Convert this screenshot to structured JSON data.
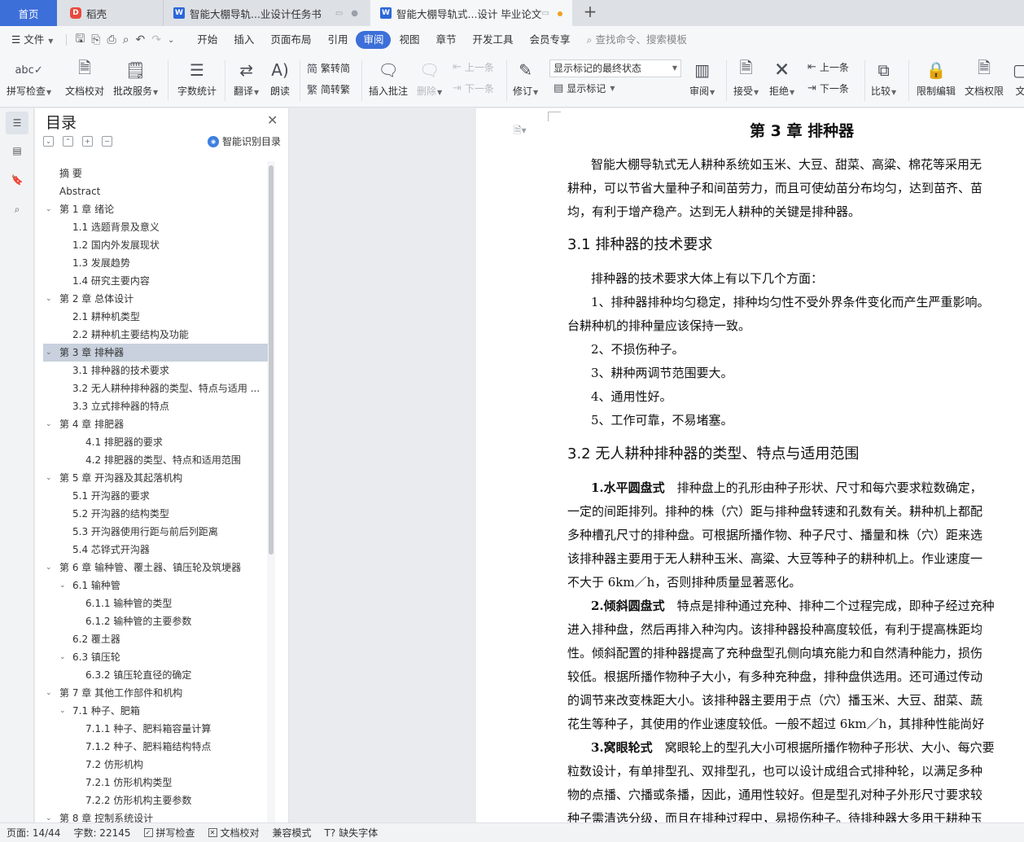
{
  "tabs": {
    "home": "首页",
    "docer": "稻壳",
    "doc1": "智能大棚导轨...业设计任务书",
    "doc2": "智能大棚导轨式...设计 毕业论文",
    "add": "+"
  },
  "menu": {
    "file": "文件",
    "items": [
      "开始",
      "插入",
      "页面布局",
      "引用",
      "审阅",
      "视图",
      "章节",
      "开发工具",
      "会员专享"
    ],
    "active": "审阅",
    "search_placeholder": "查找命令、搜索模板"
  },
  "ribbon": {
    "spell": "拼写检查",
    "doc_proof": "文档校对",
    "annotate_service": "批改服务",
    "word_count": "字数统计",
    "translate": "翻译",
    "read_aloud": "朗读",
    "trad": "繁转简",
    "simp": "简转繁",
    "insert_comment": "插入批注",
    "delete": "删除",
    "prev": "上一条",
    "next": "下一条",
    "track": "修订",
    "markup_select": "显示标记的最终状态",
    "show_markup": "显示标记",
    "review": "审阅",
    "accept": "接受",
    "reject": "拒绝",
    "prev2": "上一条",
    "next2": "下一条",
    "compare": "比较",
    "restrict": "限制编辑",
    "doc_perm": "文档权限",
    "more": "文"
  },
  "toc": {
    "title": "目录",
    "smart": "智能识别目录",
    "items": [
      {
        "text": "摘    要",
        "level": 0
      },
      {
        "text": "Abstract",
        "level": 0
      },
      {
        "text": "第 1 章  绪论",
        "level": 0,
        "exp": true
      },
      {
        "text": "1.1 选题背景及意义",
        "level": 1
      },
      {
        "text": "1.2 国内外发展现状",
        "level": 1
      },
      {
        "text": "1.3 发展趋势",
        "level": 1
      },
      {
        "text": "1.4 研究主要内容",
        "level": 1
      },
      {
        "text": "第 2 章  总体设计",
        "level": 0,
        "exp": true
      },
      {
        "text": "2.1 耕种机类型",
        "level": 1
      },
      {
        "text": "2.2 耕种机主要结构及功能",
        "level": 1
      },
      {
        "text": "第 3 章  排种器",
        "level": 0,
        "exp": true,
        "sel": true
      },
      {
        "text": "3.1 排种器的技术要求",
        "level": 1
      },
      {
        "text": "3.2 无人耕种排种器的类型、特点与适用 ...",
        "level": 1
      },
      {
        "text": "3.3 立式排种器的特点",
        "level": 1
      },
      {
        "text": "第 4 章  排肥器",
        "level": 0,
        "exp": true
      },
      {
        "text": "4.1 排肥器的要求",
        "level": 2
      },
      {
        "text": "4.2 排肥器的类型、特点和适用范围",
        "level": 2
      },
      {
        "text": "第 5 章  开沟器及其起落机构",
        "level": 0,
        "exp": true
      },
      {
        "text": "5.1 开沟器的要求",
        "level": 1
      },
      {
        "text": "5.2 开沟器的结构类型",
        "level": 1
      },
      {
        "text": "5.3 开沟器使用行距与前后列距离",
        "level": 1
      },
      {
        "text": "5.4 芯铧式开沟器",
        "level": 1
      },
      {
        "text": "第 6 章  输种管、覆土器、镇压轮及筑埂器",
        "level": 0,
        "exp": true
      },
      {
        "text": "6.1 输种管",
        "level": 1,
        "exp": true
      },
      {
        "text": "6.1.1 输种管的类型",
        "level": 2
      },
      {
        "text": "6.1.2 输种管的主要参数",
        "level": 2
      },
      {
        "text": "6.2 覆土器",
        "level": 1
      },
      {
        "text": "6.3 镇压轮",
        "level": 1,
        "exp": true
      },
      {
        "text": "6.3.2 镇压轮直径的确定",
        "level": 2
      },
      {
        "text": "第 7 章  其他工作部件和机构",
        "level": 0,
        "exp": true
      },
      {
        "text": "7.1 种子、肥箱",
        "level": 1,
        "exp": true
      },
      {
        "text": "7.1.1 种子、肥料箱容量计算",
        "level": 2
      },
      {
        "text": "7.1.2 种子、肥料箱结构特点",
        "level": 2
      },
      {
        "text": "7.2 仿形机构",
        "level": 2
      },
      {
        "text": "7.2.1 仿形机构类型",
        "level": 2
      },
      {
        "text": "7.2.2 仿形机构主要参数",
        "level": 2
      },
      {
        "text": "第 8 章  控制系统设计",
        "level": 0,
        "exp": true
      }
    ]
  },
  "doc": {
    "chapter": "第 3 章  排种器",
    "p1": [
      "智能大棚导轨式无人耕种系统如玉米、大豆、甜菜、高粱、棉花等采用无",
      "耕种，可以节省大量种子和间苗劳力，而且可使幼苗分布均匀，达到苗齐、苗",
      "均，有利于增产稳产。达到无人耕种的关键是排种器。"
    ],
    "h31": "3.1 排种器的技术要求",
    "p2": [
      "排种器的技术要求大体上有以下几个方面：",
      "1、排种器排种均匀稳定，排种均匀性不受外界条件变化而产生严重影响。",
      "台耕种机的排种量应该保持一致。",
      "2、不损伤种子。",
      "3、耕种两调节范围要大。",
      "4、通用性好。",
      "5、工作可靠，不易堵塞。"
    ],
    "h32": "3.2 无人耕种排种器的类型、特点与适用范围",
    "b1": "1.水平圆盘式",
    "p3": [
      "排种盘上的孔形由种子形状、尺寸和每穴要求粒数确定，",
      "一定的间距排列。排种的株（穴）距与排种盘转速和孔数有关。耕种机上都配",
      "多种槽孔尺寸的排种盘。可根据所播作物、种子尺寸、播量和株（穴）距来选",
      "该排种器主要用于无人耕种玉米、高粱、大豆等种子的耕种机上。作业速度一",
      "不大于 6km／h，否则排种质量显著恶化。"
    ],
    "b2": "2.倾斜圆盘式",
    "p4": [
      "特点是排种通过充种、排种二个过程完成，即种子经过充种",
      "进入排种盘，然后再排入种沟内。该排种器投种高度较低，有利于提高株距均",
      "性。倾斜配置的排种器提高了充种盘型孔侧向填充能力和自然清种能力，损伤",
      "较低。根据所播作物种子大小，有多种充种盘，排种盘供选用。还可通过传动",
      "的调节来改变株距大小。该排种器主要用于点（穴）播玉米、大豆、甜菜、蔬",
      "花生等种子，其使用的作业速度较低。一般不超过 6km／h，其排种性能尚好"
    ],
    "b3": "3.窝眼轮式",
    "p5": [
      "窝眼轮上的型孔大小可根据所播作物种子形状、大小、每穴要",
      "粒数设计，有单排型孔、双排型孔，也可以设计成组合式排种轮，以满足多种",
      "物的点播、穴播或条播，因此，通用性较好。但是型孔对种子外形尺寸要求较",
      "种子需清选分级，而且在排种过程中，易损伤种子。待排种器大多用于耕种玉"
    ]
  },
  "status": {
    "page": "页面: 14/44",
    "words": "字数: 22145",
    "spell": "拼写检查",
    "proof": "文档校对",
    "compat": "兼容模式",
    "missing_font": "缺失字体"
  }
}
